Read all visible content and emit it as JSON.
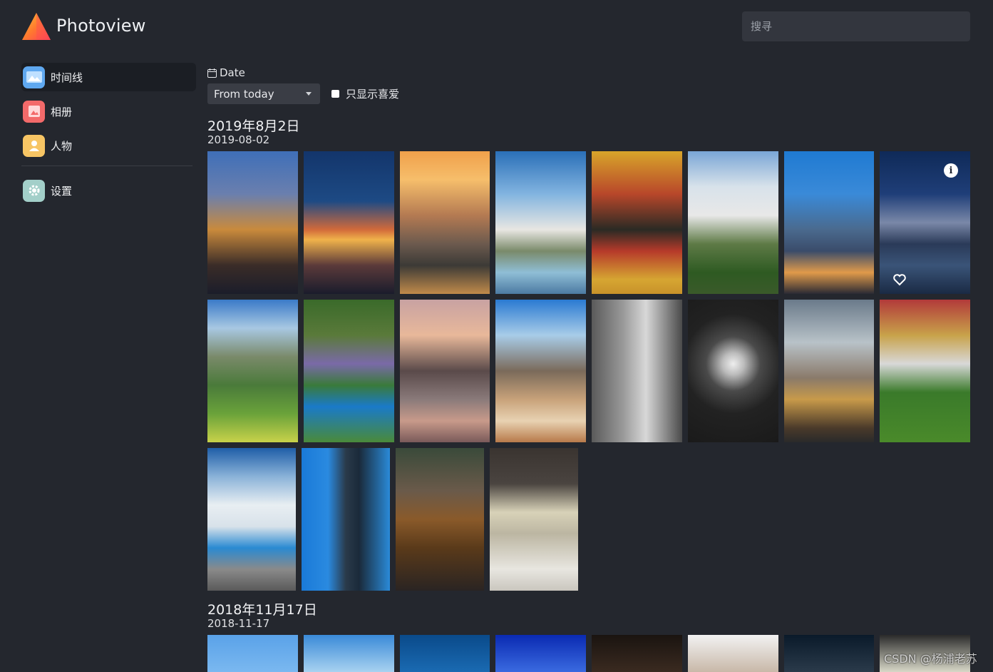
{
  "app": {
    "name": "Photoview"
  },
  "search": {
    "placeholder": "搜寻"
  },
  "sidebar": {
    "items": [
      {
        "label": "时间线",
        "icon": "timeline-icon",
        "color": "#5fa8f0",
        "active": true
      },
      {
        "label": "相册",
        "icon": "album-icon",
        "color": "#f36a6a",
        "active": false
      },
      {
        "label": "人物",
        "icon": "people-icon",
        "color": "#f7c564",
        "active": false
      },
      {
        "label": "设置",
        "icon": "settings-icon",
        "color": "#a3cfc9",
        "active": false
      }
    ]
  },
  "filters": {
    "date_label": "Date",
    "order_value": "From today",
    "favorites_label": "只显示喜爱"
  },
  "groups": [
    {
      "title": "2019年8月2日",
      "date": "2019-08-02"
    },
    {
      "title": "2018年11月17日",
      "date": "2018-11-17"
    }
  ],
  "watermark": "CSDN @杨浦老苏"
}
